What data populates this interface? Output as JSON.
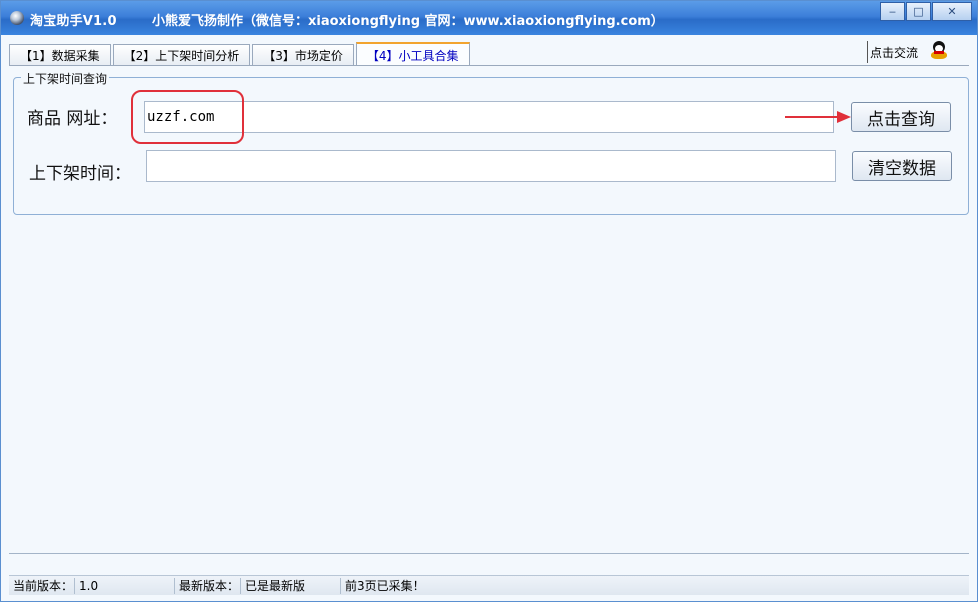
{
  "window": {
    "title": "淘宝助手V1.0",
    "author": "小熊爱飞扬制作（微信号：xiaoxiongflying  官网：www.xiaoxiongflying.com）"
  },
  "window_controls": {
    "minimize": "‒",
    "maximize": "□",
    "close": "✕"
  },
  "tabs": [
    {
      "label": "【1】数据采集"
    },
    {
      "label": "【2】上下架时间分析"
    },
    {
      "label": "【3】市场定价"
    },
    {
      "label": "【4】小工具合集"
    }
  ],
  "active_tab": 3,
  "chat_link": {
    "label": "点击交流",
    "icon": "qq-penguin-icon"
  },
  "query_group": {
    "legend": "上下架时间查询",
    "url_label": "商品  网址：",
    "url_value": "uzzf.com",
    "time_label": "上下架时间：",
    "time_value": "",
    "query_button": "点击查询",
    "clear_button": "清空数据"
  },
  "annotation": {
    "highlight_color": "#e0303a"
  },
  "statusbar": {
    "current_version_label": "当前版本：",
    "current_version": "1.0",
    "latest_version_label": "最新版本：",
    "latest_version": "已是最新版",
    "message": "前3页已采集！"
  },
  "colors": {
    "titlebar": "#3c7fd9",
    "active_tab_text": "#0000c0",
    "active_tab_accent": "#f2a42f"
  }
}
